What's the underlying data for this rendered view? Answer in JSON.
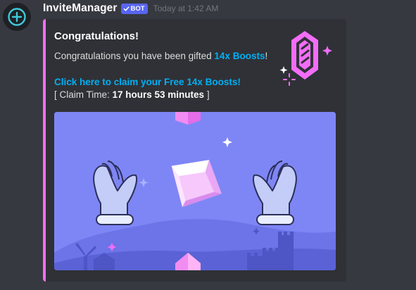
{
  "message": {
    "username": "InviteManager",
    "bot_badge": "BOT",
    "timestamp": "Today at 1:42 AM"
  },
  "embed": {
    "title": "Congratulations!",
    "description_prefix": "Congratulations you have been gifted ",
    "description_highlight": "14x Boosts",
    "description_suffix": "!",
    "claim_link": "Click here to claim your Free 14x Boosts!",
    "claim_time_prefix": "[ Claim Time: ",
    "claim_time_value": "17 hours 53 minutes",
    "claim_time_suffix": " ]",
    "accent_color": "#f26df7",
    "link_color": "#00b0f4"
  },
  "icons": {
    "add_reaction": "plus-circle-icon",
    "verified": "checkmark-icon",
    "thumbnail": "nitro-gem-icon",
    "image": "boost-gift-illustration"
  }
}
